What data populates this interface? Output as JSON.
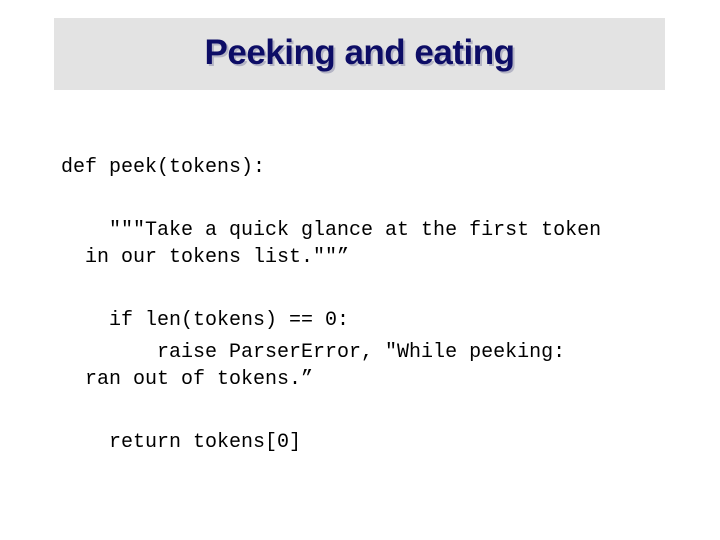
{
  "slide": {
    "title": "Peeking and eating",
    "code_lines": [
      "def peek(tokens):",
      "    \"\"\"Take a quick glance at the first token",
      "  in our tokens list.\"\"”",
      "    if len(tokens) == 0:",
      "        raise ParserError, \"While peeking:",
      "  ran out of tokens.”",
      "    return tokens[0]"
    ]
  },
  "colors": {
    "title_bar_background": "#e3e3e3",
    "title_text": "#0d0d66",
    "code_text": "#000000"
  }
}
